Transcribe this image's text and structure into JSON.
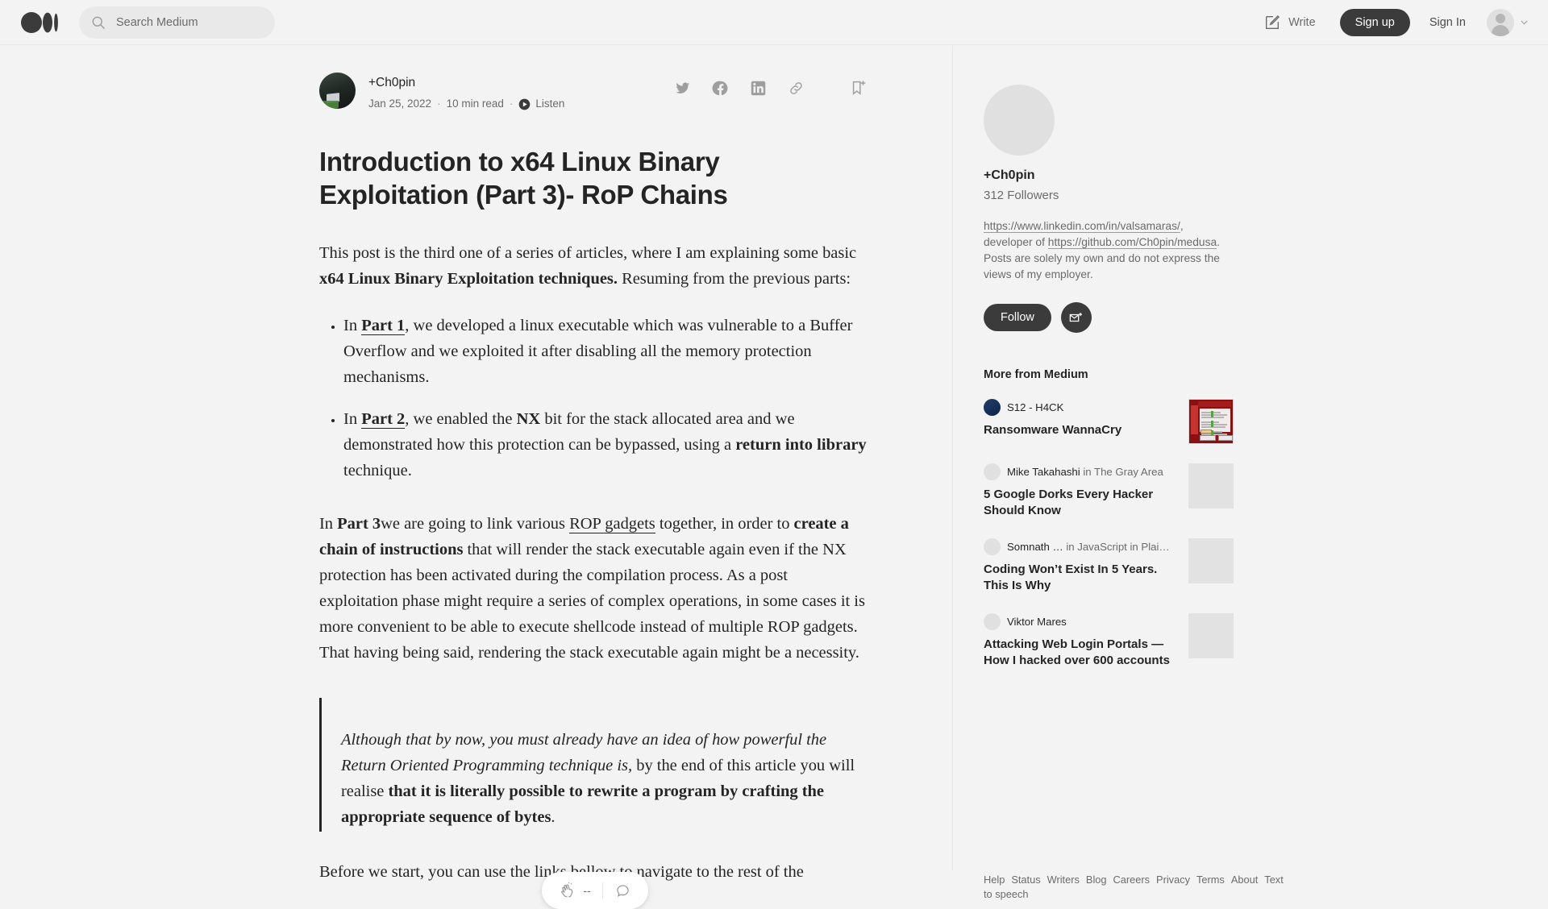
{
  "nav": {
    "logo": "medium-logo",
    "search_placeholder": "Search Medium",
    "search_value": "",
    "write_label": "Write",
    "signup_label": "Sign up",
    "signin_label": "Sign In"
  },
  "article": {
    "author": "+Ch0pin",
    "date": "Jan 25, 2022",
    "read_time": "10 min read",
    "listen_label": "Listen",
    "separator": "·",
    "title": "Introduction to x64 Linux Binary Exploitation (Part 3)- RoP Chains",
    "paragraph1": {
      "a": "This post is the third one of a series of articles, where I am explaining some basic ",
      "b_bold": "x64 Linux Binary Exploitation techniques.",
      "c": " Resuming from the previous parts:"
    },
    "bullets": [
      {
        "a": "In ",
        "link": "Part 1",
        "b": ", we developed a linux executable which was vulnerable to a Buffer Overflow and we exploited it after disabling all the memory protection mechanisms."
      },
      {
        "a": "In ",
        "link": "Part 2",
        "b": ", we enabled the ",
        "bold1": "NX",
        "c": " bit for the stack allocated area and we demonstrated how this protection can be bypassed, using a ",
        "bold2": "return into library",
        "d": " technique."
      }
    ],
    "paragraph2": {
      "a": "In ",
      "bold1": "Part 3",
      "b": "we are going to link various ",
      "link": "ROP gadgets",
      "c": " together, in order to ",
      "bold2": "create a chain of instructions",
      "d": " that will render the stack executable again even if the NX protection has been activated during the compilation process. As a post exploitation phase might require a series of complex operations, in some cases it is more convenient to be able to execute shellcode instead of multiple ROP gadgets. That having being said, rendering the stack executable again might be a necessity."
    },
    "blockquote": {
      "italic": "Although that by now, you must already have an idea of how powerful the Return Oriented Programming technique is,",
      "a": " by the end of this article you will realise ",
      "bold": "that it is literally possible to rewrite a program by crafting the appropriate sequence of bytes",
      "b": "."
    },
    "paragraph3": "Before we start, you can use the links bellow to navigate to the rest of the"
  },
  "clapbar": {
    "clap_count": "--"
  },
  "sidebar": {
    "name": "+Ch0pin",
    "followers": "312 Followers",
    "bio": {
      "link1": "https://www.linkedin.com/in/valsamaras/",
      "mid": ", developer of ",
      "link2": "https://github.com/Ch0pin/medusa",
      "rest": ". Posts are solely my own and do not express the views of my employer."
    },
    "follow_label": "Follow",
    "more_from_label": "More from Medium",
    "recommendations": [
      {
        "author": "S12 - H4CK",
        "publication": "",
        "in_label": "",
        "title": "Ransomware WannaCry",
        "thumb": "wannacry-screenshot"
      },
      {
        "author": "Mike Takahashi",
        "publication": "The Gray Area",
        "in_label": "in",
        "title": "5 Google Dorks Every Hacker Should Know",
        "thumb": "placeholder"
      },
      {
        "author": "Somnath …",
        "publication": "JavaScript in Plai…",
        "in_label": "in",
        "title": "Coding Won’t Exist In 5 Years. This Is Why",
        "thumb": "placeholder"
      },
      {
        "author": "Viktor Mares",
        "publication": "",
        "in_label": "",
        "title": "Attacking Web Login Portals — How I hacked over 600 accounts",
        "thumb": "placeholder"
      }
    ]
  },
  "footer": {
    "links": [
      "Help",
      "Status",
      "Writers",
      "Blog",
      "Careers",
      "Privacy",
      "Terms",
      "About",
      "Text to speech"
    ]
  },
  "colors": {
    "page_bg": "#f3f3f3",
    "text": "#242424",
    "muted": "#6b6b6b",
    "button_dark": "#3b3b3b",
    "divider": "#e8e8e8"
  }
}
